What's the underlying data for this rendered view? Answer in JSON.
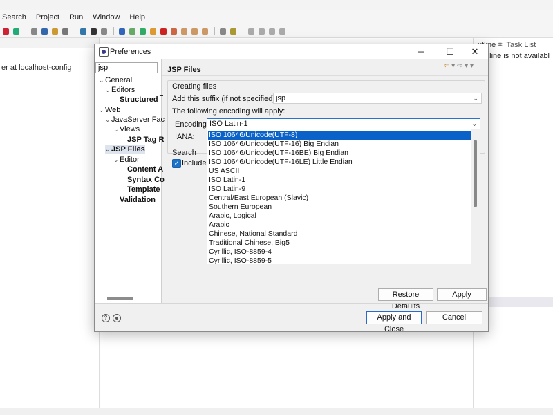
{
  "ide": {
    "menu": [
      "Search",
      "Project",
      "Run",
      "Window",
      "Help"
    ],
    "left_pane_text": "er at localhost-config",
    "right_tabs": {
      "outline": "utline ⌗",
      "tasks": "Task List"
    },
    "right_pane_text": "utline is not availabl"
  },
  "dialog": {
    "title": "Preferences",
    "filter_value": "jsp",
    "tree": [
      {
        "label": "General",
        "twisty": "⌄"
      },
      {
        "label": "Editors",
        "twisty": "⌄"
      },
      {
        "label": "Structured ‾",
        "twisty": ""
      },
      {
        "label": "Web",
        "twisty": "⌄"
      },
      {
        "label": "JavaServer Fac",
        "twisty": "⌄"
      },
      {
        "label": "Views",
        "twisty": "⌄"
      },
      {
        "label": "JSP Tag R",
        "twisty": ""
      },
      {
        "label": "JSP Files",
        "twisty": "⌄"
      },
      {
        "label": "Editor",
        "twisty": "⌄"
      },
      {
        "label": "Content A",
        "twisty": ""
      },
      {
        "label": "Syntax Co",
        "twisty": ""
      },
      {
        "label": "Template",
        "twisty": ""
      },
      {
        "label": "Validation",
        "twisty": ""
      }
    ],
    "page_title": "JSP Files",
    "group_label": "Creating files",
    "suffix_label": "Add this suffix (if not specified):",
    "suffix_value": "jsp",
    "encoding_note": "The following encoding will apply:",
    "encoding_label": "Encoding:",
    "encoding_value": "ISO Latin-1",
    "iana_label": "IANA:",
    "search_label": "Search",
    "include_label": "Include",
    "encoding_options": [
      "ISO 10646/Unicode(UTF-8)",
      "ISO 10646/Unicode(UTF-16) Big Endian",
      "ISO 10646/Unicode(UTF-16BE) Big Endian",
      "ISO 10646/Unicode(UTF-16LE) Little Endian",
      "US ASCII",
      "ISO Latin-1",
      "ISO Latin-9",
      "Central/East European (Slavic)",
      "Southern European",
      "Arabic, Logical",
      "Arabic",
      "Chinese, National Standard",
      "Traditional Chinese, Big5",
      "Cyrillic, ISO-8859-4",
      "Cyrillic, ISO-8859-5"
    ],
    "highlighted_option": "ISO 10646/Unicode(UTF-8)",
    "buttons": {
      "restore_defaults": "Restore Defaults",
      "apply": "Apply",
      "apply_and_close": "Apply and Close",
      "cancel": "Cancel"
    }
  },
  "colors": {
    "selection_blue": "#0a62c9",
    "focus_border": "#2673cc"
  }
}
